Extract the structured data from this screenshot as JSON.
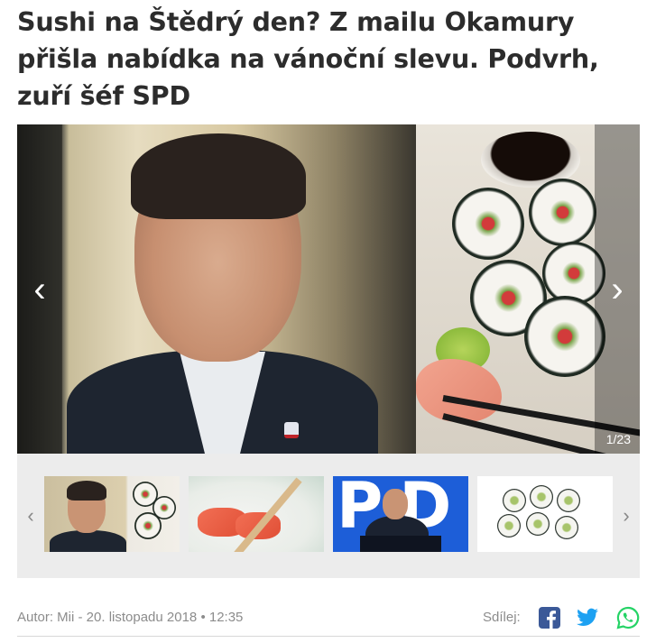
{
  "article": {
    "title": "Sushi na Štědrý den? Z mailu Okamury přišla nabídka na vánoční slevu. Podvrh, zuří šéf SPD"
  },
  "gallery": {
    "counter": "1/23",
    "prev_arrow": "‹",
    "next_arrow": "›",
    "thumb_prev": "‹",
    "thumb_next": "›"
  },
  "meta": {
    "byline": "Autor: Mii - 20. listopadu 2018 • 12:35",
    "share_label": "Sdílej:"
  },
  "icons": {
    "facebook": "facebook-icon",
    "twitter": "twitter-icon",
    "whatsapp": "whatsapp-icon"
  },
  "colors": {
    "facebook": "#3b5998",
    "twitter": "#1da1f2",
    "whatsapp": "#25d366",
    "headline": "#2c2c2c"
  }
}
